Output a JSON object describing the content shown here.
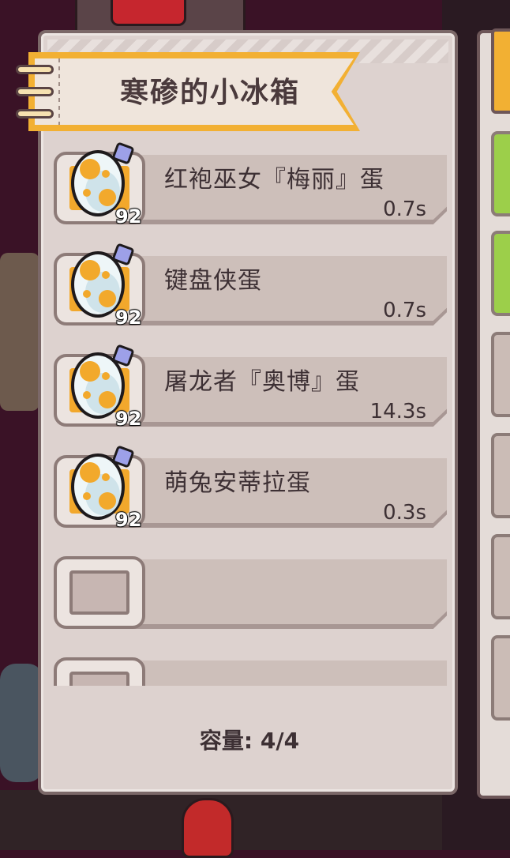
{
  "panel": {
    "title": "寒碜的小冰箱",
    "capacity_text": "容量: 4/4"
  },
  "eggs": [
    {
      "name": "红袍巫女『梅丽』蛋",
      "time": "0.7s",
      "level": "92",
      "icon": "spotted-egg-icon"
    },
    {
      "name": "键盘侠蛋",
      "time": "0.7s",
      "level": "92",
      "icon": "spotted-egg-icon"
    },
    {
      "name": "屠龙者『奥博』蛋",
      "time": "14.3s",
      "level": "92",
      "icon": "spotted-egg-icon"
    },
    {
      "name": "萌兔安蒂拉蛋",
      "time": "0.3s",
      "level": "92",
      "icon": "spotted-egg-icon"
    }
  ],
  "colors": {
    "accent": "#f2b033",
    "panel_bg": "#ddd2cf",
    "text": "#3d3034"
  }
}
